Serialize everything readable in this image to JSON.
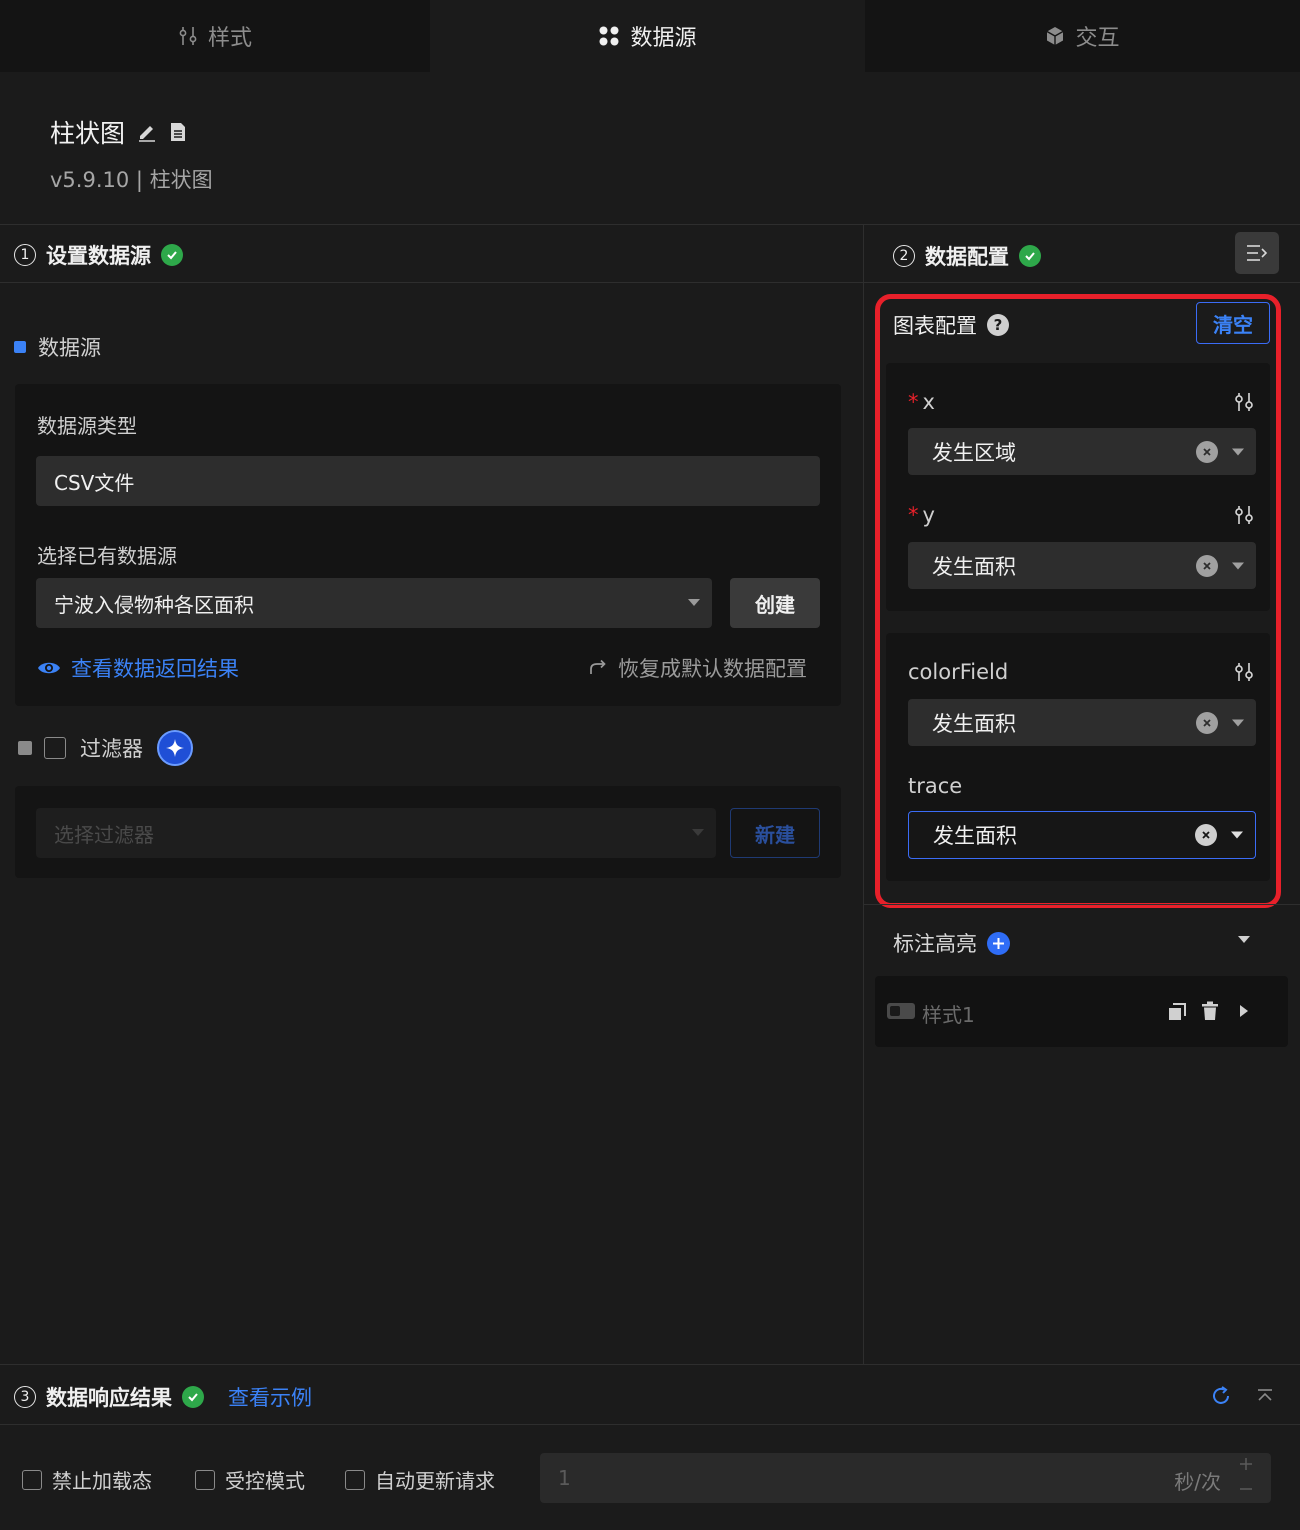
{
  "tabs": [
    {
      "label": "样式",
      "icon": "sliders-icon"
    },
    {
      "label": "数据源",
      "icon": "grid-icon"
    },
    {
      "label": "交互",
      "icon": "cube-icon"
    }
  ],
  "component": {
    "title": "柱状图",
    "subtitle": "v5.9.10 | 柱状图"
  },
  "section1": {
    "num": "1",
    "title": "设置数据源",
    "datasource_heading": "数据源",
    "type_label": "数据源类型",
    "type_value": "CSV文件",
    "existing_label": "选择已有数据源",
    "existing_value": "宁波入侵物种各区面积",
    "create_button": "创建",
    "view_result_link": "查看数据返回结果",
    "restore_link": "恢复成默认数据配置",
    "filter_label": "过滤器",
    "filter_placeholder": "选择过滤器",
    "filter_new_button": "新建"
  },
  "section2": {
    "num": "2",
    "title": "数据配置",
    "chart_config_label": "图表配置",
    "clear_button": "清空",
    "fields": [
      {
        "name": "x",
        "required": true,
        "value": "发生区域"
      },
      {
        "name": "y",
        "required": true,
        "value": "发生面积"
      },
      {
        "name": "colorField",
        "required": false,
        "value": "发生面积"
      },
      {
        "name": "trace",
        "required": false,
        "value": "发生面积"
      }
    ],
    "highlight_label": "标注高亮",
    "style_item": "样式1"
  },
  "section3": {
    "num": "3",
    "title": "数据响应结果",
    "example_link": "查看示例",
    "options": [
      "禁止加载态",
      "受控模式",
      "自动更新请求"
    ],
    "interval_value": "1",
    "interval_unit": "秒/次"
  },
  "colors": {
    "accent": "#3b82f6",
    "success": "#2ea84a",
    "highlight_box": "#e8202a"
  }
}
